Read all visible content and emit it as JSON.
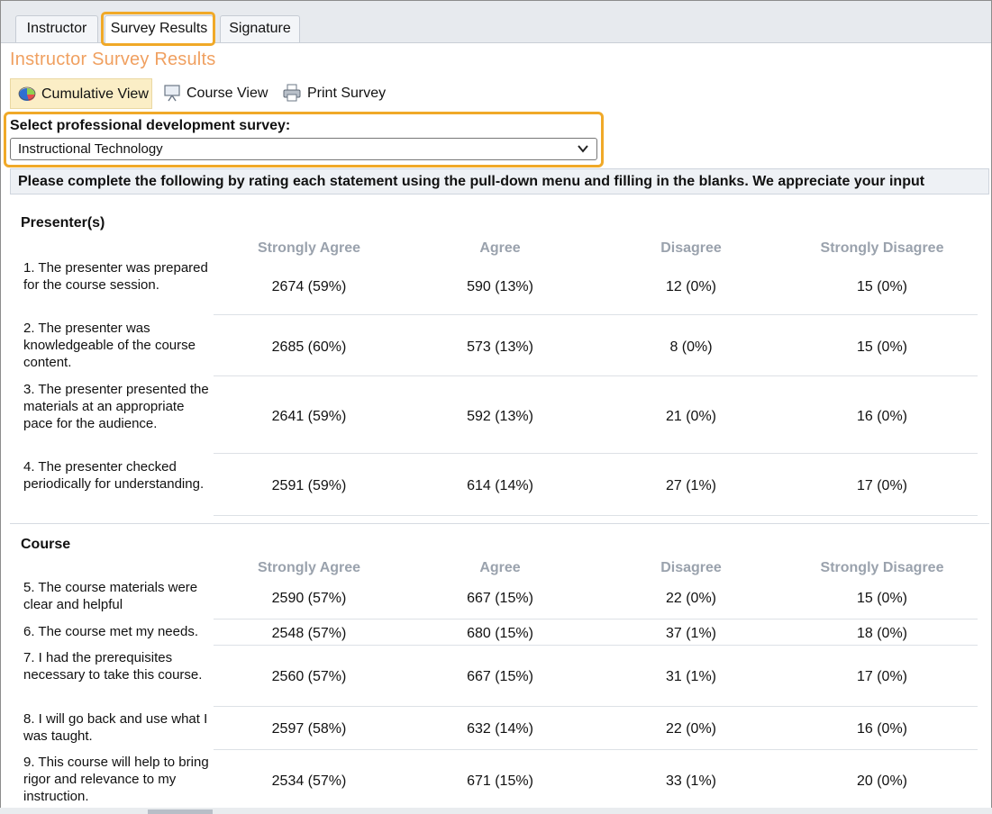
{
  "tabs": [
    {
      "label": "Instructor"
    },
    {
      "label": "Survey Results"
    },
    {
      "label": "Signature"
    }
  ],
  "page_title": "Instructor Survey Results",
  "view_toolbar": {
    "cumulative": "Cumulative View",
    "course": "Course View",
    "print": "Print Survey"
  },
  "survey_select": {
    "label": "Select professional development survey:",
    "value": "Instructional Technology"
  },
  "instructions": "Please complete the following by rating each statement using the pull-down menu and filling in the blanks. We appreciate your input",
  "columns": [
    "Strongly Agree",
    "Agree",
    "Disagree",
    "Strongly Disagree"
  ],
  "sections": [
    {
      "title": "Presenter(s)",
      "questions": [
        {
          "text": "1. The presenter was prepared for the course session.",
          "values": [
            "2674 (59%)",
            "590 (13%)",
            "12 (0%)",
            "15 (0%)"
          ]
        },
        {
          "text": "2. The presenter was knowledgeable of the course content.",
          "values": [
            "2685 (60%)",
            "573 (13%)",
            "8 (0%)",
            "15 (0%)"
          ]
        },
        {
          "text": "3. The presenter presented the materials at an appropriate pace for the audience.",
          "values": [
            "2641 (59%)",
            "592 (13%)",
            "21 (0%)",
            "16 (0%)"
          ]
        },
        {
          "text": "4. The presenter checked periodically for understanding.",
          "values": [
            "2591 (59%)",
            "614 (14%)",
            "27 (1%)",
            "17 (0%)"
          ]
        }
      ]
    },
    {
      "title": "Course",
      "questions": [
        {
          "text": "5. The course materials were clear and helpful",
          "values": [
            "2590 (57%)",
            "667 (15%)",
            "22 (0%)",
            "15 (0%)"
          ]
        },
        {
          "text": "6. The course met my needs.",
          "values": [
            "2548 (57%)",
            "680 (15%)",
            "37 (1%)",
            "18 (0%)"
          ]
        },
        {
          "text": "7. I had the prerequisites necessary to take this course.",
          "values": [
            "2560 (57%)",
            "667 (15%)",
            "31 (1%)",
            "17 (0%)"
          ]
        },
        {
          "text": "8. I will go back and use what I was taught.",
          "values": [
            "2597 (58%)",
            "632 (14%)",
            "22 (0%)",
            "16 (0%)"
          ]
        },
        {
          "text": "9. This course will help to bring rigor and relevance to my instruction.",
          "values": [
            "2534 (57%)",
            "671 (15%)",
            "33 (1%)",
            "20 (0%)"
          ]
        }
      ]
    }
  ],
  "colors": {
    "highlight": "#f0a928",
    "title_orange": "#f0a060",
    "header_gray": "#9aa2ad",
    "active_view_bg": "#fbeec6"
  }
}
